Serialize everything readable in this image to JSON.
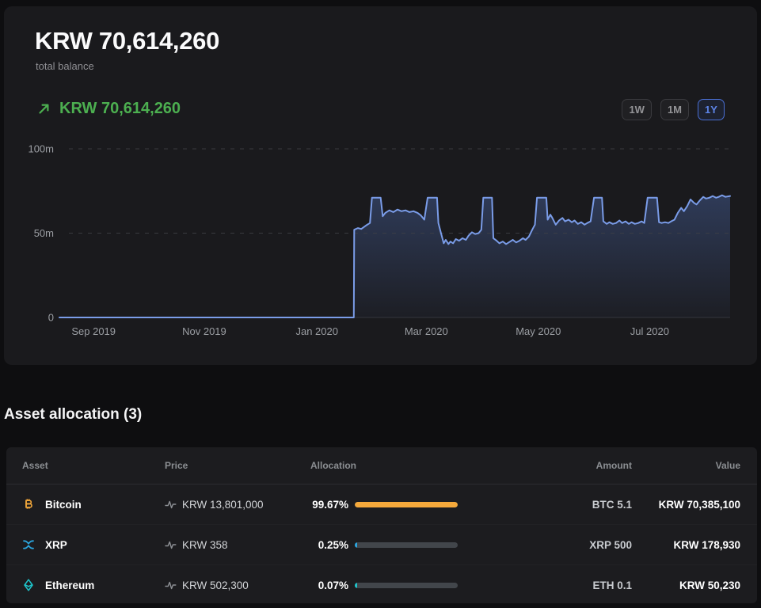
{
  "colors": {
    "positive_green": "#4caf50",
    "active_range_blue": "#5d84e6",
    "chart_line": "#7a9ce8",
    "chart_fill_top": "#5c82d8",
    "bar_track": "#42464b",
    "card_bg": "#1a1a1d",
    "page_bg": "#0e0e10"
  },
  "header": {
    "total_balance": "KRW 70,614,260",
    "total_balance_label": "total balance",
    "change_value": "KRW 70,614,260"
  },
  "range_buttons": [
    {
      "label": "1W",
      "active": false
    },
    {
      "label": "1M",
      "active": false
    },
    {
      "label": "1Y",
      "active": true
    }
  ],
  "chart_data": {
    "type": "area",
    "title": "portfolio balance over 1 year",
    "unit": "millions of KRW",
    "ylim": [
      0,
      100
    ],
    "grid": "dashed horizontal",
    "y_ticks": [
      {
        "label": "100m",
        "value": 100
      },
      {
        "label": "50m",
        "value": 50
      },
      {
        "label": "0",
        "value": 0
      }
    ],
    "x_ticks": [
      {
        "label": "Sep 2019",
        "f": 0.051
      },
      {
        "label": "Nov 2019",
        "f": 0.216
      },
      {
        "label": "Jan 2020",
        "f": 0.384
      },
      {
        "label": "Mar 2020",
        "f": 0.547
      },
      {
        "label": "May 2020",
        "f": 0.714
      },
      {
        "label": "Jul 2020",
        "f": 0.88
      }
    ],
    "points": [
      [
        0,
        0
      ],
      [
        0.439,
        0
      ],
      [
        0.4395,
        52
      ],
      [
        0.445,
        53
      ],
      [
        0.45,
        52.5
      ],
      [
        0.457,
        54.5
      ],
      [
        0.463,
        56
      ],
      [
        0.466,
        71
      ],
      [
        0.479,
        71
      ],
      [
        0.482,
        60
      ],
      [
        0.486,
        62
      ],
      [
        0.492,
        63.5
      ],
      [
        0.498,
        62.5
      ],
      [
        0.504,
        64
      ],
      [
        0.51,
        63
      ],
      [
        0.516,
        63.5
      ],
      [
        0.522,
        62.5
      ],
      [
        0.528,
        63
      ],
      [
        0.534,
        62
      ],
      [
        0.539,
        60.5
      ],
      [
        0.544,
        58
      ],
      [
        0.549,
        71
      ],
      [
        0.563,
        71
      ],
      [
        0.565,
        56
      ],
      [
        0.569,
        50
      ],
      [
        0.573,
        44
      ],
      [
        0.576,
        46
      ],
      [
        0.58,
        43.5
      ],
      [
        0.583,
        45
      ],
      [
        0.587,
        44
      ],
      [
        0.591,
        46.5
      ],
      [
        0.596,
        45.5
      ],
      [
        0.601,
        47
      ],
      [
        0.606,
        46
      ],
      [
        0.61,
        48.5
      ],
      [
        0.615,
        50.5
      ],
      [
        0.62,
        49.5
      ],
      [
        0.625,
        50
      ],
      [
        0.629,
        52
      ],
      [
        0.632,
        71
      ],
      [
        0.645,
        71
      ],
      [
        0.647,
        47
      ],
      [
        0.652,
        45.5
      ],
      [
        0.656,
        44
      ],
      [
        0.661,
        45
      ],
      [
        0.666,
        43.5
      ],
      [
        0.67,
        44.5
      ],
      [
        0.676,
        46
      ],
      [
        0.681,
        44.5
      ],
      [
        0.686,
        45.5
      ],
      [
        0.691,
        47
      ],
      [
        0.695,
        46
      ],
      [
        0.7,
        48
      ],
      [
        0.705,
        52
      ],
      [
        0.709,
        55
      ],
      [
        0.712,
        71
      ],
      [
        0.726,
        71
      ],
      [
        0.728,
        58
      ],
      [
        0.732,
        61
      ],
      [
        0.735,
        59
      ],
      [
        0.74,
        55
      ],
      [
        0.745,
        57.5
      ],
      [
        0.75,
        59
      ],
      [
        0.754,
        57
      ],
      [
        0.759,
        58
      ],
      [
        0.764,
        56.5
      ],
      [
        0.768,
        57.5
      ],
      [
        0.773,
        55.5
      ],
      [
        0.778,
        56.5
      ],
      [
        0.783,
        55
      ],
      [
        0.787,
        56
      ],
      [
        0.792,
        57
      ],
      [
        0.797,
        71
      ],
      [
        0.809,
        71
      ],
      [
        0.811,
        57
      ],
      [
        0.816,
        55.5
      ],
      [
        0.82,
        56.5
      ],
      [
        0.825,
        55.5
      ],
      [
        0.83,
        56
      ],
      [
        0.835,
        57.5
      ],
      [
        0.839,
        56
      ],
      [
        0.844,
        57
      ],
      [
        0.849,
        55.5
      ],
      [
        0.853,
        56.5
      ],
      [
        0.858,
        55.5
      ],
      [
        0.863,
        56
      ],
      [
        0.868,
        57
      ],
      [
        0.872,
        56
      ],
      [
        0.877,
        71
      ],
      [
        0.891,
        71
      ],
      [
        0.894,
        56.5
      ],
      [
        0.898,
        56
      ],
      [
        0.903,
        56.5
      ],
      [
        0.908,
        56
      ],
      [
        0.912,
        57
      ],
      [
        0.917,
        58
      ],
      [
        0.922,
        62
      ],
      [
        0.927,
        65
      ],
      [
        0.931,
        63
      ],
      [
        0.936,
        66
      ],
      [
        0.941,
        70
      ],
      [
        0.946,
        68
      ],
      [
        0.95,
        67
      ],
      [
        0.955,
        69.5
      ],
      [
        0.96,
        71.5
      ],
      [
        0.964,
        70.5
      ],
      [
        0.969,
        71
      ],
      [
        0.974,
        72
      ],
      [
        0.979,
        71
      ],
      [
        0.983,
        71.5
      ],
      [
        0.988,
        72.5
      ],
      [
        0.993,
        71.5
      ],
      [
        1,
        72
      ]
    ]
  },
  "allocation": {
    "title": "Asset allocation (3)",
    "columns": {
      "asset": "Asset",
      "price": "Price",
      "allocation": "Allocation",
      "amount": "Amount",
      "value": "Value"
    },
    "rows": [
      {
        "asset": "Bitcoin",
        "icon": "bitcoin-icon",
        "color": "#f5a93b",
        "price": "KRW 13,801,000",
        "allocation_pct": "99.67%",
        "allocation_value": 99.67,
        "amount": "BTC 5.1",
        "value": "KRW 70,385,100"
      },
      {
        "asset": "XRP",
        "icon": "xrp-icon",
        "color": "#2ba6df",
        "price": "KRW 358",
        "allocation_pct": "0.25%",
        "allocation_value": 0.25,
        "amount": "XRP 500",
        "value": "KRW 178,930"
      },
      {
        "asset": "Ethereum",
        "icon": "ethereum-icon",
        "color": "#1fc4cb",
        "price": "KRW 502,300",
        "allocation_pct": "0.07%",
        "allocation_value": 0.07,
        "amount": "ETH 0.1",
        "value": "KRW 50,230"
      }
    ]
  }
}
